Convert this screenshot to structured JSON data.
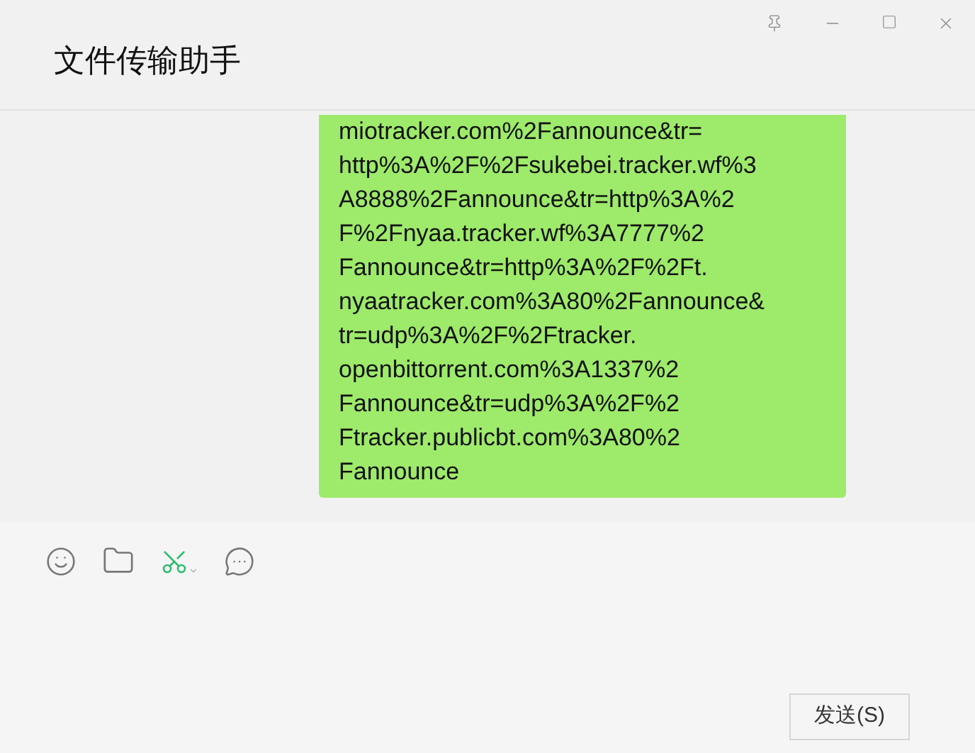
{
  "window": {
    "title": "文件传输助手"
  },
  "message": {
    "lines": [
      "miotracker.com%2Fannounce&tr=",
      "http%3A%2F%2Fsukebei.tracker.wf%3",
      "A8888%2Fannounce&tr=http%3A%2",
      "F%2Fnyaa.tracker.wf%3A7777%2",
      "Fannounce&tr=http%3A%2F%2Ft.",
      "nyaatracker.com%3A80%2Fannounce&",
      "tr=udp%3A%2F%2Ftracker.",
      "openbittorrent.com%3A1337%2",
      "Fannounce&tr=udp%3A%2F%2",
      "Ftracker.publicbt.com%3A80%2",
      "Fannounce"
    ]
  },
  "send_button": {
    "label": "发送(S)"
  }
}
